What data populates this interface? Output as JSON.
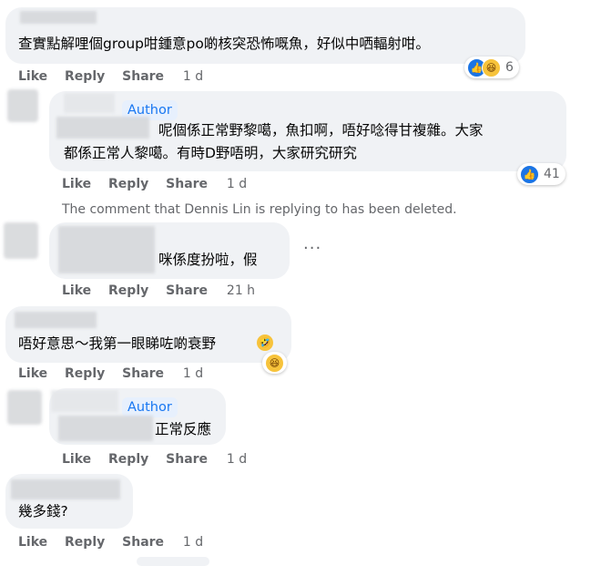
{
  "comments": [
    {
      "text": "查實點解哩個group咁鍾意po啲核突恐怖嘅魚，好似中哂輻射咁。",
      "actions": {
        "like": "Like",
        "reply": "Reply",
        "share": "Share",
        "time": "1 d"
      },
      "reactions": {
        "count": "6",
        "icons": [
          "like-icon",
          "haha-icon"
        ]
      }
    },
    {
      "badge": "Author",
      "text_line1": "呢個係正常野黎噶，魚扣啊，唔好唸得甘複雜。大家",
      "text_line2": "都係正常人黎噶。有時D野唔明，大家研究研究",
      "actions": {
        "like": "Like",
        "reply": "Reply",
        "share": "Share",
        "time": "1 d"
      },
      "reactions": {
        "count": "41",
        "icons": [
          "like-icon"
        ]
      }
    },
    {
      "deleted_notice": "The comment that Dennis Lin is replying to has been deleted.",
      "text": "咪係度扮啦，假",
      "more": "···",
      "actions": {
        "like": "Like",
        "reply": "Reply",
        "share": "Share",
        "time": "21 h"
      }
    },
    {
      "text": "唔好意思～我第一眼睇咗啲衰野",
      "actions": {
        "like": "Like",
        "reply": "Reply",
        "share": "Share",
        "time": "1 d"
      },
      "reactions": {
        "icons": [
          "haha-icon"
        ]
      }
    },
    {
      "badge": "Author",
      "text": "正常反應",
      "actions": {
        "like": "Like",
        "reply": "Reply",
        "share": "Share",
        "time": "1 d"
      }
    },
    {
      "text": "幾多錢?",
      "actions": {
        "like": "Like",
        "reply": "Reply",
        "share": "Share",
        "time": "1 d"
      }
    }
  ]
}
